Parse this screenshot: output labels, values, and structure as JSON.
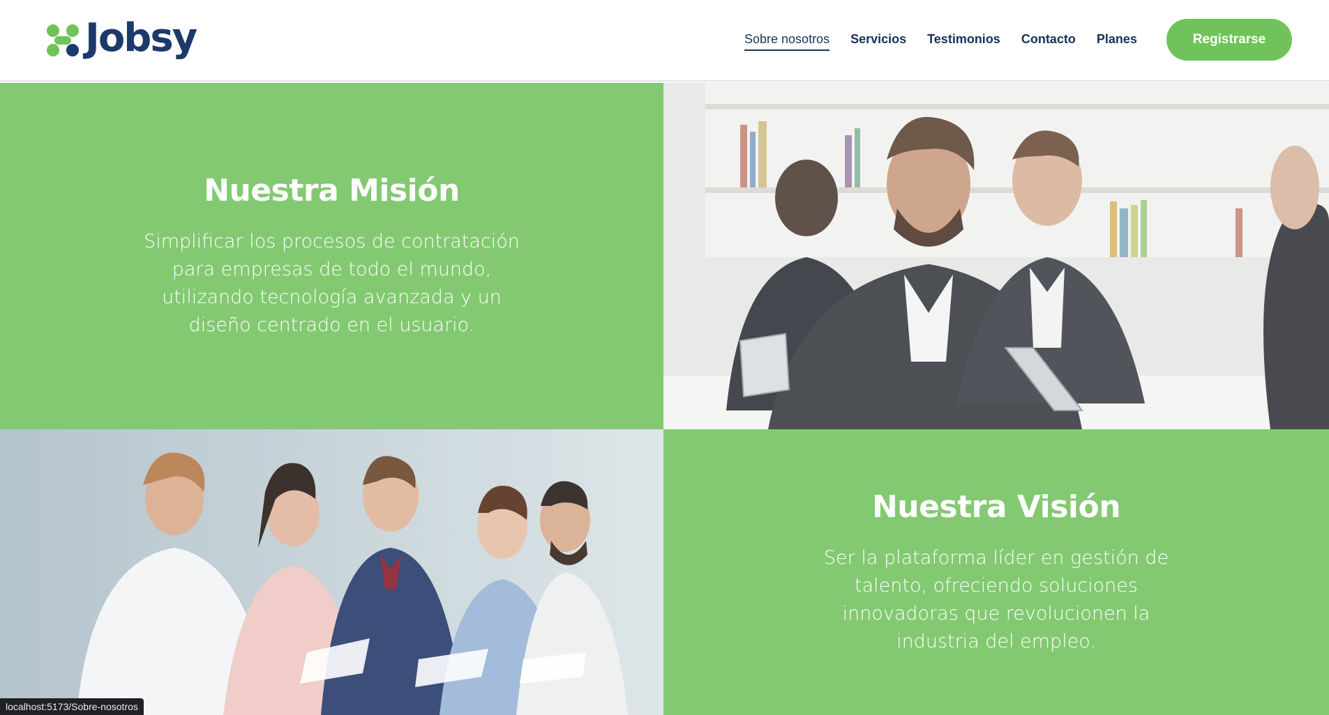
{
  "brand": {
    "name": "Jobsy",
    "primary_color": "#1b3a6b",
    "accent_color": "#6fc35a"
  },
  "nav": {
    "items": [
      {
        "label": "Sobre nosotros",
        "active": true
      },
      {
        "label": "Servicios",
        "active": false
      },
      {
        "label": "Testimonios",
        "active": false
      },
      {
        "label": "Contacto",
        "active": false
      },
      {
        "label": "Planes",
        "active": false
      }
    ],
    "register_label": "Registrarse"
  },
  "mission": {
    "title": "Nuestra Misión",
    "text": "Simplificar los procesos de contratación para empresas de todo el mundo, utilizando tecnología avanzada y un diseño centrado en el usuario."
  },
  "vision": {
    "title": "Nuestra Visión",
    "text": "Ser la plataforma líder en gestión de talento, ofreciendo soluciones innovadoras que revolucionen la industria del empleo."
  },
  "images": {
    "office_meeting": "photo: business team meeting around table, man smiling at camera",
    "job_candidates": "photo: row of job candidates seated holding resumes"
  },
  "status_bar": {
    "url": "localhost:5173/Sobre-nosotros"
  },
  "panel_color": "#83c972"
}
